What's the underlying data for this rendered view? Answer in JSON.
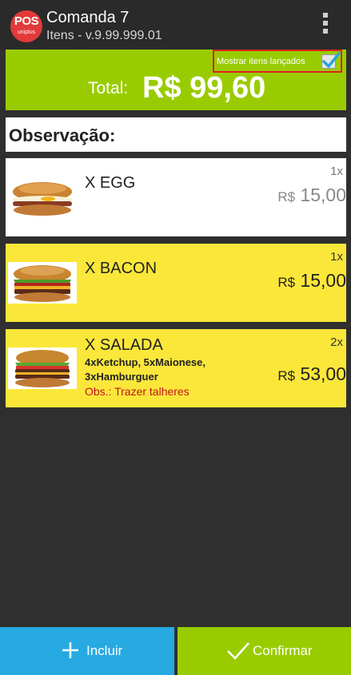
{
  "appbar": {
    "logo_text": "POS",
    "logo_subtext": "uniplus",
    "title": "Comanda 7",
    "subtitle": "Itens - v.9.99.999.01",
    "menu_icon": "overflow-menu-icon"
  },
  "summary": {
    "show_launched_label": "Mostrar itens lançados",
    "show_launched_checked": true,
    "total_label": "Total:",
    "total_value": "R$ 99,60"
  },
  "observation": {
    "label": "Observação:"
  },
  "items": [
    {
      "name": "X EGG",
      "qty": "1x",
      "currency": "R$",
      "price": "15,00",
      "details": "",
      "note": "",
      "highlight": false,
      "image_icon": "burger-egg-photo"
    },
    {
      "name": "X BACON",
      "qty": "1x",
      "currency": "R$",
      "price": "15,00",
      "details": "",
      "note": "",
      "highlight": true,
      "image_icon": "burger-bacon-photo"
    },
    {
      "name": "X SALADA",
      "qty": "2x",
      "currency": "R$",
      "price": "53,00",
      "details": "4xKetchup, 5xMaionese, 3xHamburguer",
      "note": "Obs.: Trazer talheres",
      "highlight": true,
      "image_icon": "burger-salad-photo"
    }
  ],
  "footer": {
    "add_label": "Incluir",
    "confirm_label": "Confirmar"
  },
  "colors": {
    "green": "#99cc00",
    "blue": "#27a9e1",
    "yellow": "#fbe73a",
    "red": "#e02020",
    "background": "#2f2f2f"
  }
}
